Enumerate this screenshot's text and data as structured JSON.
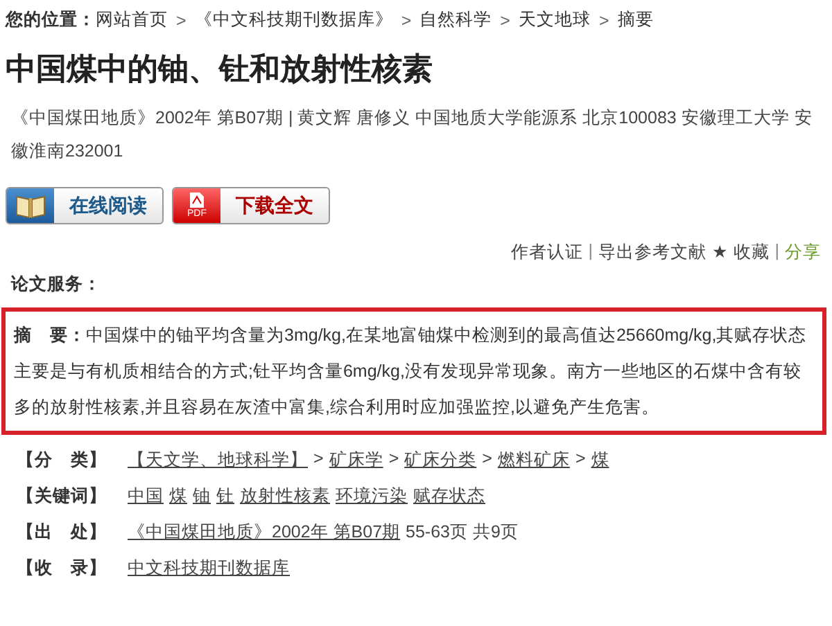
{
  "breadcrumb": {
    "label": "您的位置：",
    "separator": ">",
    "items": [
      "网站首页",
      "《中文科技期刊数据库》",
      "自然科学",
      "天文地球",
      "摘要"
    ]
  },
  "title": "中国煤中的铀、钍和放射性核素",
  "meta": "《中国煤田地质》2002年 第B07期 | 黄文辉 唐修义   中国地质大学能源系 北京100083 安徽理工大学 安徽淮南232001",
  "buttons": [
    {
      "kind": "read",
      "label": "在线阅读"
    },
    {
      "kind": "pdf",
      "label": "下载全文",
      "icon_text": "PDF"
    }
  ],
  "actions": [
    {
      "kind": "link",
      "text": "作者认证"
    },
    {
      "kind": "sep",
      "text": "|"
    },
    {
      "kind": "link",
      "text": "导出参考文献"
    },
    {
      "kind": "star",
      "text": "★"
    },
    {
      "kind": "link",
      "text": "收藏"
    },
    {
      "kind": "sep",
      "text": "|"
    },
    {
      "kind": "share",
      "text": "分享"
    }
  ],
  "services_label": "论文服务：",
  "abstract": {
    "label": "摘　要：",
    "text": "中国煤中的铀平均含量为3mg/kg,在某地富铀煤中检测到的最高值达25660mg/kg,其赋存状态主要是与有机质相结合的方式;钍平均含量6mg/kg,没有发现异常现象。南方一些地区的石煤中含有较多的放射性核素,并且容易在灰渣中富集,综合利用时应加强监控,以避免产生危害。"
  },
  "info": [
    {
      "label": "【分　类】",
      "parts": [
        {
          "kind": "link",
          "text": "【天文学、地球科学】"
        },
        {
          "kind": "plain",
          "text": ">"
        },
        {
          "kind": "link",
          "text": "矿床学"
        },
        {
          "kind": "plain",
          "text": ">"
        },
        {
          "kind": "link",
          "text": "矿床分类"
        },
        {
          "kind": "plain",
          "text": ">"
        },
        {
          "kind": "link",
          "text": "燃料矿床"
        },
        {
          "kind": "plain",
          "text": ">"
        },
        {
          "kind": "link",
          "text": "煤"
        }
      ]
    },
    {
      "label": "【关键词】",
      "parts": [
        {
          "kind": "link",
          "text": "中国"
        },
        {
          "kind": "link",
          "text": "煤"
        },
        {
          "kind": "link",
          "text": "铀"
        },
        {
          "kind": "link",
          "text": "钍"
        },
        {
          "kind": "link",
          "text": "放射性核素"
        },
        {
          "kind": "link",
          "text": "环境污染"
        },
        {
          "kind": "link",
          "text": "赋存状态"
        }
      ]
    },
    {
      "label": "【出　处】",
      "parts": [
        {
          "kind": "link",
          "text": "《中国煤田地质》2002年 第B07期"
        },
        {
          "kind": "plain",
          "text": "55-63页 共9页"
        }
      ]
    },
    {
      "label": "【收　录】",
      "parts": [
        {
          "kind": "link",
          "text": "中文科技期刊数据库"
        }
      ]
    }
  ]
}
